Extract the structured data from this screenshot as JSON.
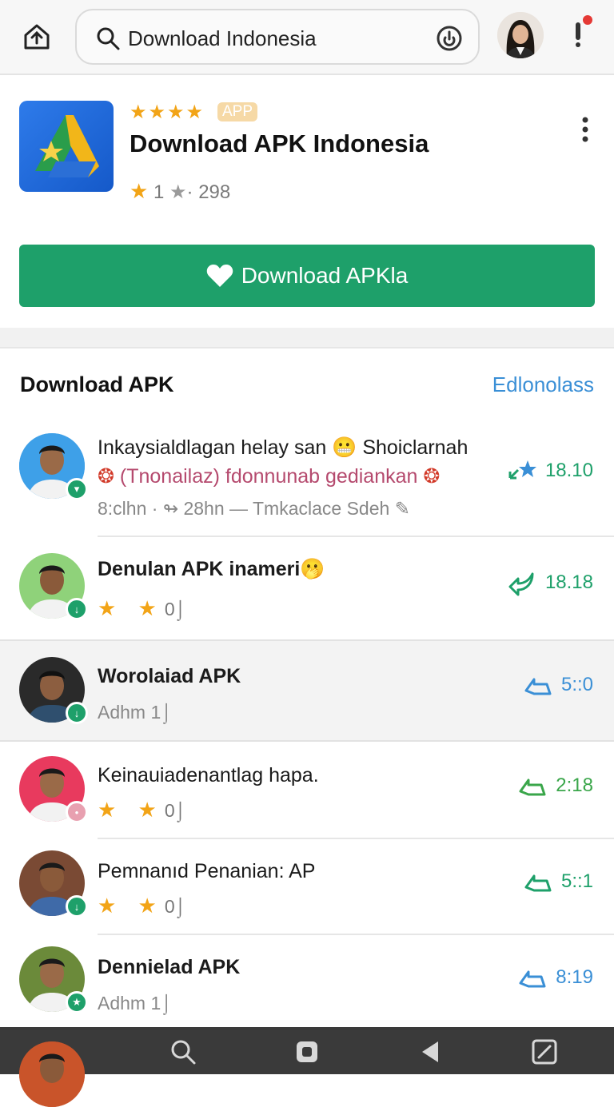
{
  "search": {
    "query": "Download Indonesia"
  },
  "app": {
    "stars": "★★★★",
    "badge": "APP",
    "title": "Download APK Indonesia",
    "rating_a": "1",
    "rating_b": "· 298",
    "download_label": "Download APKla"
  },
  "section": {
    "title": "Download APK",
    "link": "Edlonolass"
  },
  "rows": [
    {
      "title_line1": "Inkaysialdlagan helay san 😬 Shoiclarnah",
      "title_line2": "(Tnonailaz) fdonnunab gediankan",
      "meta": "8:clhn · ↬ 28hn — Tmkaclace Sdeh ✎",
      "time": "18.10",
      "color": "#1ea06a"
    },
    {
      "title": "Denulan APK inameri🫢",
      "stars": "★ ★",
      "count": "0⌡",
      "time": "18.18",
      "color": "#1ea06a"
    },
    {
      "title": "Worolaiad APK",
      "sub": "Adhm 1⌡",
      "time": "5::0",
      "color": "#3a8fd6"
    },
    {
      "title": "Keinauiadenantlag hapa.",
      "stars": "★ ★",
      "count": "0⌡",
      "time": "2:18",
      "color": "#3aa64a"
    },
    {
      "title": "Pemnanıd Penanian: AP",
      "stars": "★ ★",
      "count": "0⌡",
      "time": "5::1",
      "color": "#1ea06a"
    },
    {
      "title": "Dennielad APK",
      "sub": "Adhm 1⌡",
      "time": "8:19",
      "color": "#3a8fd6"
    }
  ],
  "colors": {
    "accent_green": "#1ea06a",
    "link_blue": "#3a8fd6",
    "star": "#f2a417"
  }
}
